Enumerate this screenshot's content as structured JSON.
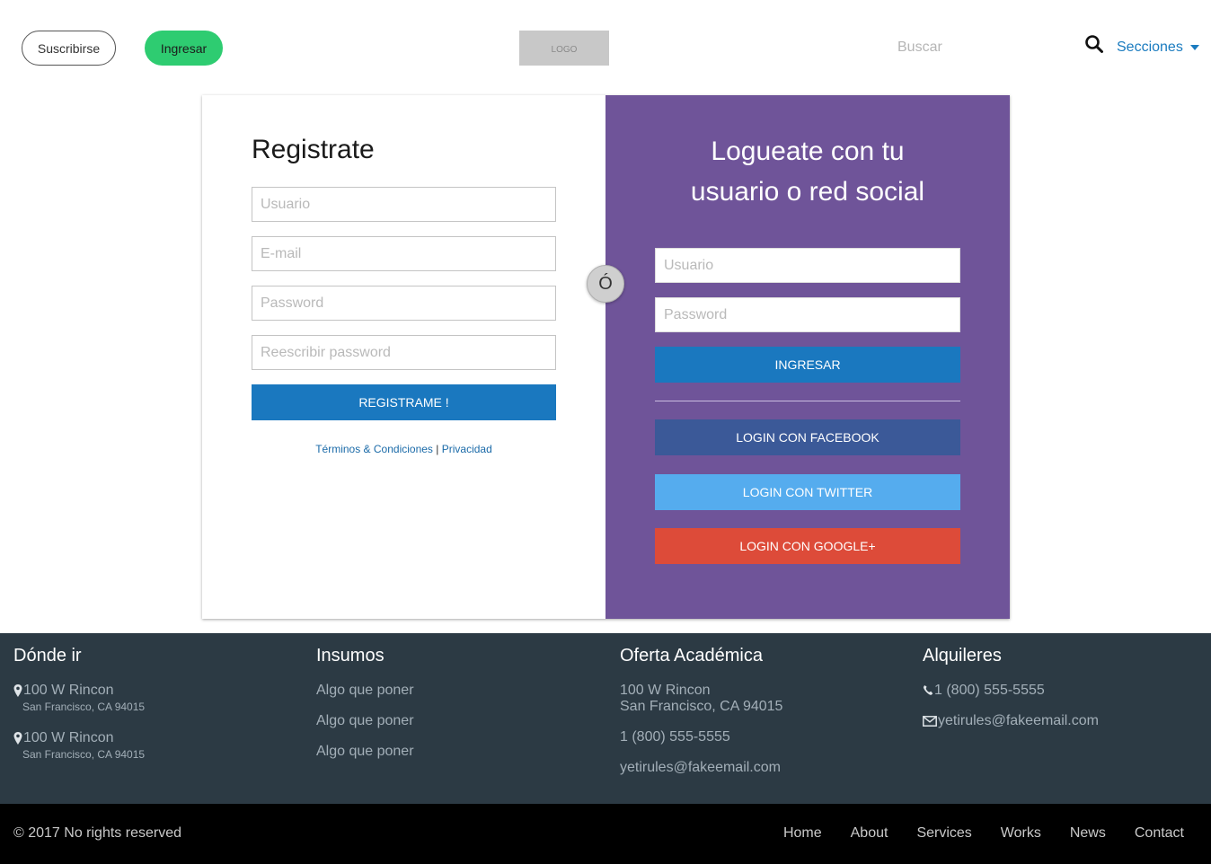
{
  "header": {
    "subscribe_label": "Suscribirse",
    "login_label": "Ingresar",
    "logo_text": "LOGO",
    "search_placeholder": "Buscar",
    "sections_label": "Secciones"
  },
  "register": {
    "title": "Registrate",
    "username_placeholder": "Usuario",
    "email_placeholder": "E-mail",
    "password_placeholder": "Password",
    "repeat_password_placeholder": "Reescribir password",
    "submit_label": "REGISTRAME !",
    "terms_label": "Términos & Condiciones",
    "separator": "|",
    "privacy_label": "Privacidad"
  },
  "or_label": "Ó",
  "login": {
    "title_line1": "Logueate con tu",
    "title_line2": "usuario o red social",
    "username_placeholder": "Usuario",
    "password_placeholder": "Password",
    "submit_label": "INGRESAR",
    "facebook_label": "LOGIN CON FACEBOOK",
    "twitter_label": "LOGIN CON TWITTER",
    "google_label": "LOGIN CON GOOGLE+"
  },
  "footer": {
    "col1": {
      "title": "Dónde ir",
      "places": [
        {
          "street": "100 W Rincon",
          "city": "San Francisco, CA 94015"
        },
        {
          "street": "100 W Rincon",
          "city": "San Francisco, CA 94015"
        }
      ]
    },
    "col2": {
      "title": "Insumos",
      "items": [
        "Algo que poner",
        "Algo que poner",
        "Algo que poner"
      ]
    },
    "col3": {
      "title": "Oferta Académica",
      "street": "100 W Rincon",
      "city": "San Francisco, CA 94015",
      "phone": "1 (800) 555-5555",
      "email": "yetirules@fakeemail.com"
    },
    "col4": {
      "title": "Alquileres",
      "phone": "1 (800) 555-5555",
      "email": "yetirules@fakeemail.com"
    }
  },
  "bottom": {
    "copyright": "© 2017 No rights reserved",
    "nav": [
      "Home",
      "About",
      "Services",
      "Works",
      "News",
      "Contact"
    ]
  },
  "colors": {
    "accent_blue": "#1a78bf",
    "green": "#2ecc71",
    "purple": "#6f5499",
    "facebook": "#3b5998",
    "twitter": "#55acee",
    "google": "#dd4b39",
    "footer_bg": "#2c3a44"
  },
  "icons": [
    "search-icon",
    "chevron-down-icon",
    "map-marker-icon",
    "phone-icon",
    "envelope-icon"
  ]
}
